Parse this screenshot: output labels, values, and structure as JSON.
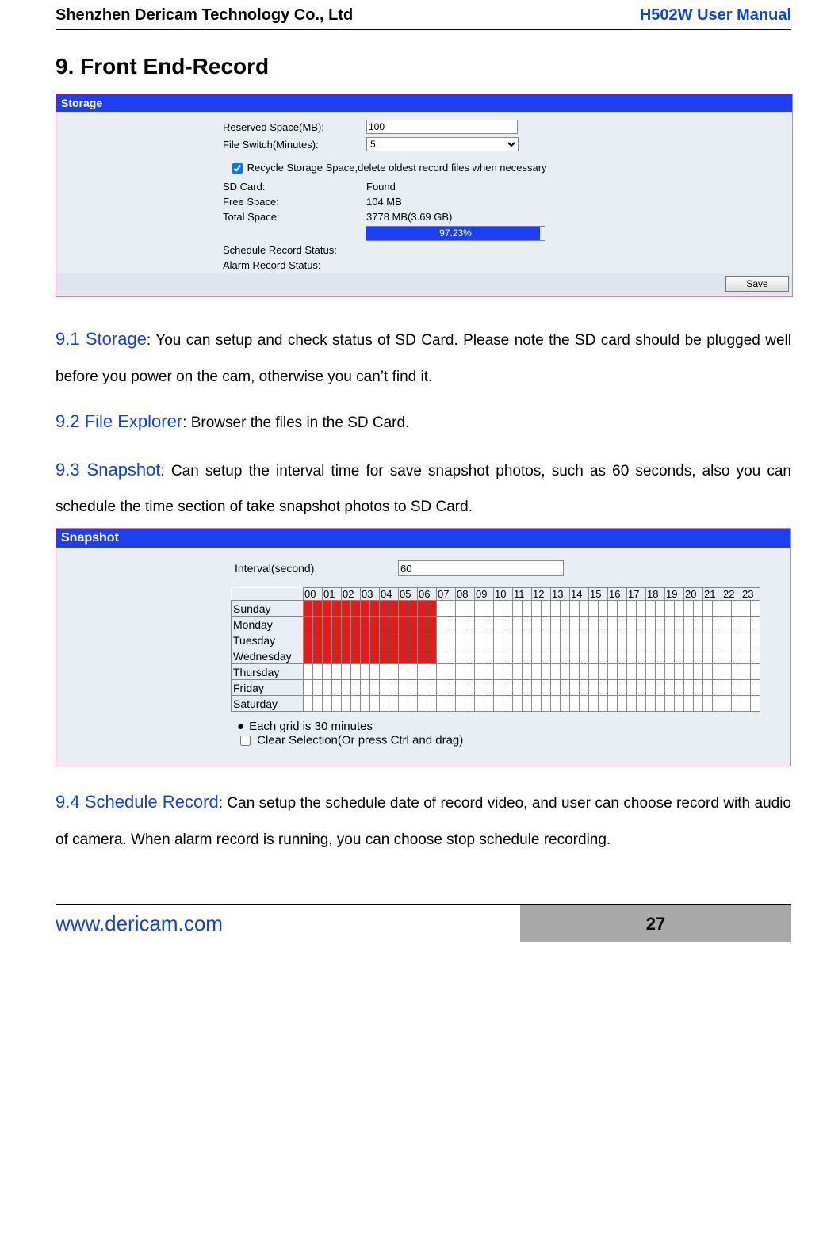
{
  "header": {
    "company": "Shenzhen Dericam Technology Co., Ltd",
    "doc_title": "H502W User Manual"
  },
  "section_title": "9. Front End-Record",
  "storage_panel": {
    "title": "Storage",
    "reserved_label": "Reserved Space(MB):",
    "reserved_value": "100",
    "file_switch_label": "File Switch(Minutes):",
    "file_switch_value": "5",
    "recycle_label": "Recycle Storage Space,delete oldest record files when necessary",
    "sd_label": "SD Card:",
    "sd_value": "Found",
    "free_label": "Free Space:",
    "free_value": "104 MB",
    "total_label": "Total Space:",
    "total_value": "3778 MB(3.69 GB)",
    "progress_pct": "97.23%",
    "schedule_status_label": "Schedule Record Status:",
    "alarm_status_label": "Alarm Record Status:",
    "save_btn": "Save"
  },
  "sections": {
    "s91_head": "9.1 Storage",
    "s91_text": ": You can setup and check status of SD Card. Please note the SD card should be plugged well before you power on the cam, otherwise you can’t find it.",
    "s92_head": "9.2 File Explorer",
    "s92_text": ": Browser the files in the SD Card.",
    "s93_head": "9.3 Snapshot",
    "s93_text": ": Can setup the interval time for save snapshot photos, such as 60 seconds, also you can schedule the time section of take snapshot photos to SD Card.",
    "s94_head": "9.4 Schedule Record",
    "s94_text": ": Can setup the schedule date of record video, and user can choose record with audio of camera. When alarm record is running, you can choose stop schedule recording."
  },
  "snapshot_panel": {
    "title": "Snapshot",
    "interval_label": "Interval(second):",
    "interval_value": "60",
    "hours": [
      "00",
      "01",
      "02",
      "03",
      "04",
      "05",
      "06",
      "07",
      "08",
      "09",
      "10",
      "11",
      "12",
      "13",
      "14",
      "15",
      "16",
      "17",
      "18",
      "19",
      "20",
      "21",
      "22",
      "23"
    ],
    "days": [
      "Sunday",
      "Monday",
      "Tuesday",
      "Wednesday",
      "Thursday",
      "Friday",
      "Saturday"
    ],
    "half_hours_per_day": 48,
    "red_days": [
      "Sunday",
      "Monday",
      "Tuesday",
      "Wednesday"
    ],
    "red_half_hours": 14,
    "note1": "Each grid is 30 minutes",
    "note2": "Clear Selection(Or press Ctrl and drag)"
  },
  "footer": {
    "url": "www.dericam.com",
    "page": "27"
  }
}
